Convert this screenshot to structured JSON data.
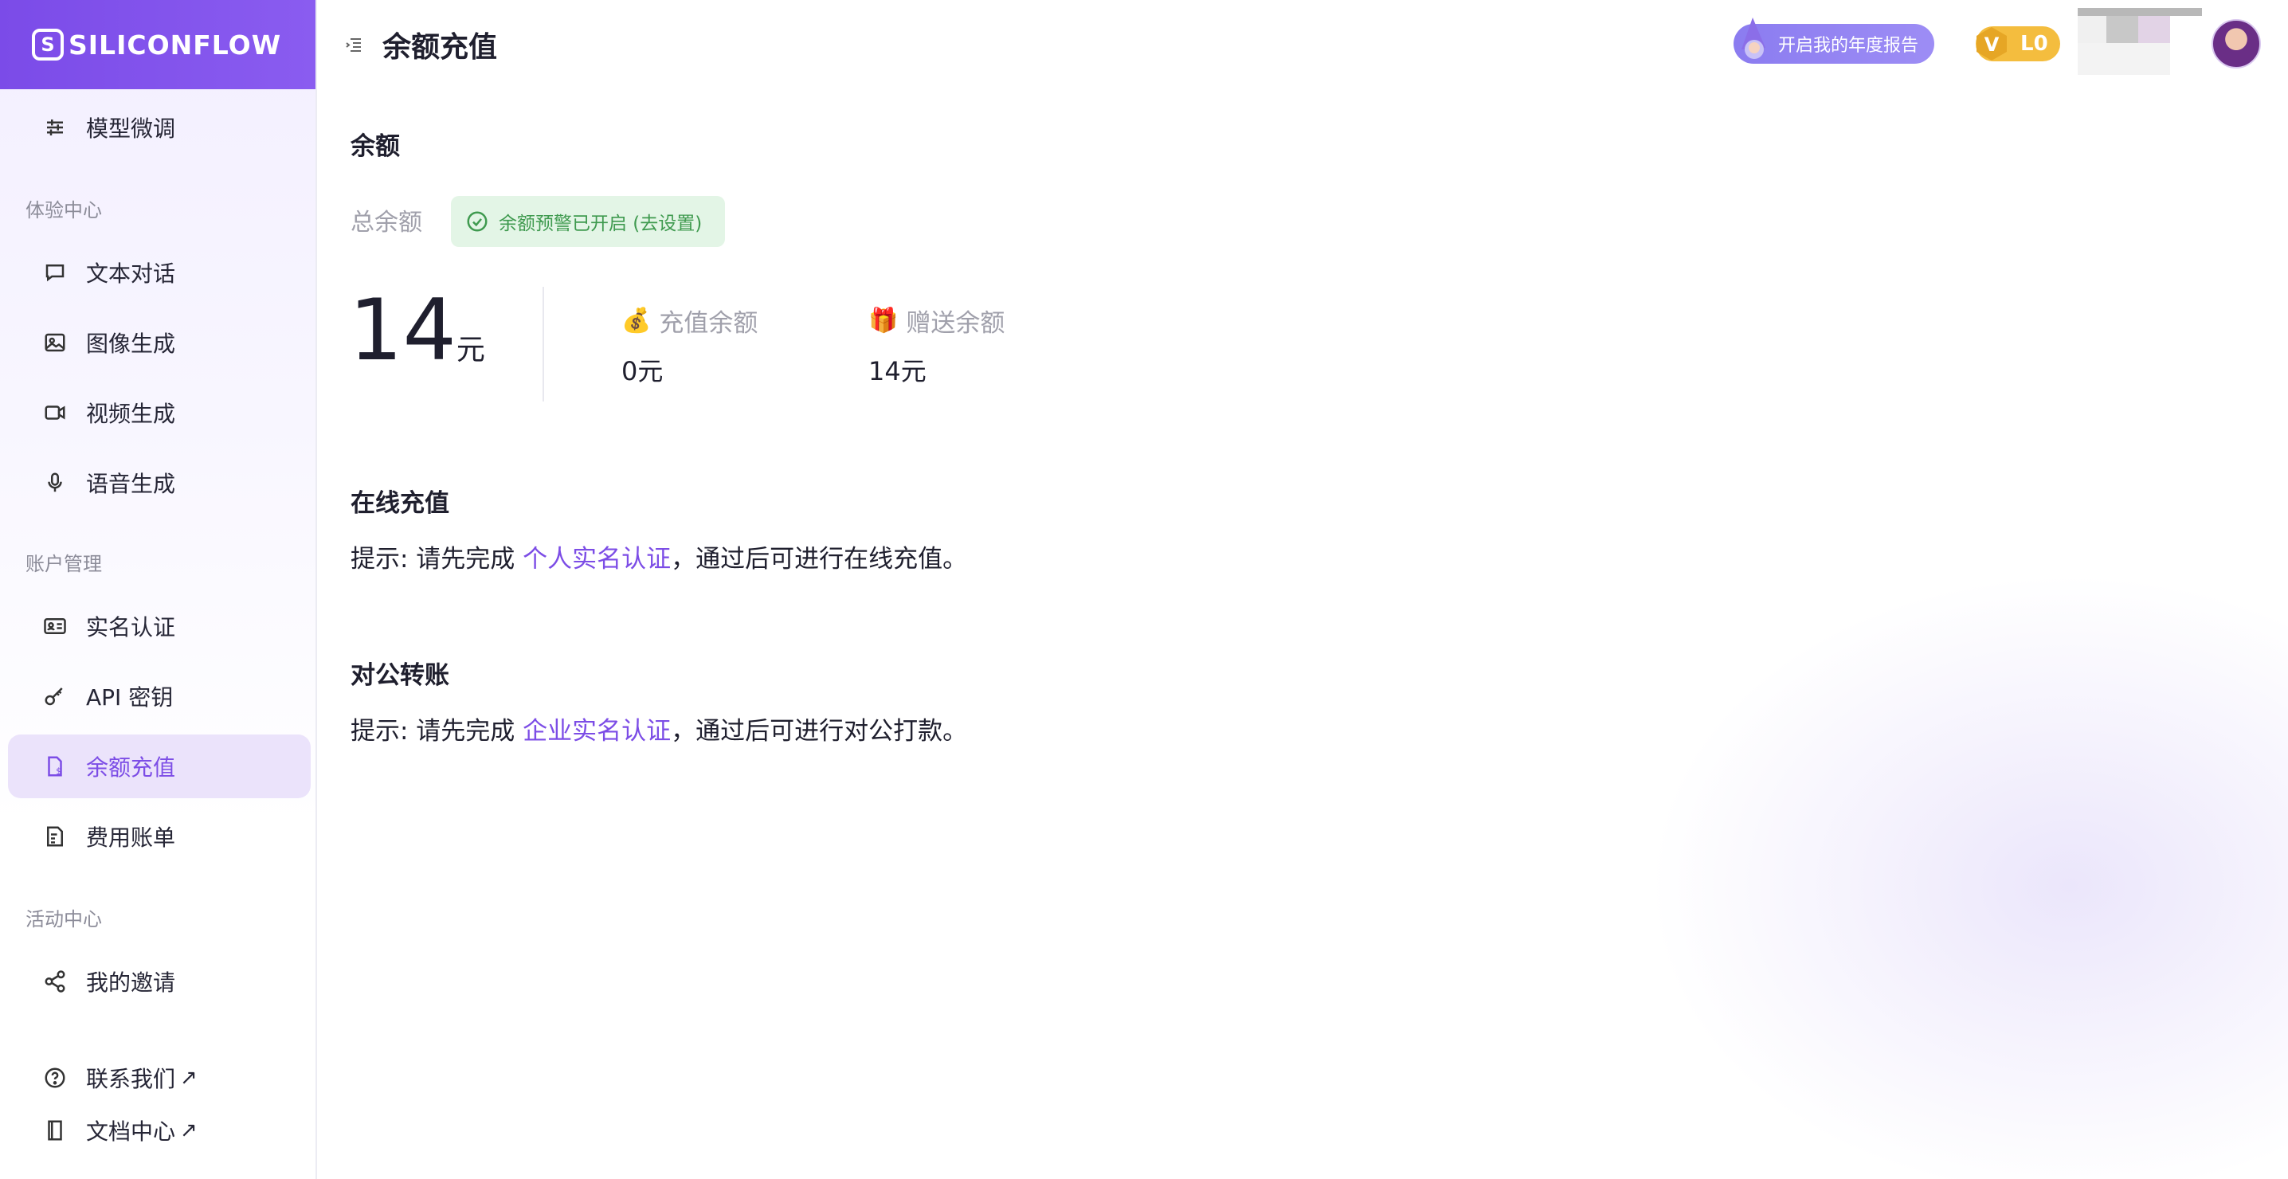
{
  "brand": {
    "name": "SILICONFLOW"
  },
  "sidebar": {
    "top_item": {
      "label": "模型微调",
      "icon": "sliders-icon"
    },
    "sections": [
      {
        "label": "体验中心"
      },
      {
        "label": "账户管理"
      },
      {
        "label": "活动中心"
      }
    ],
    "items": [
      {
        "label": "文本对话",
        "icon": "chat-icon"
      },
      {
        "label": "图像生成",
        "icon": "image-icon"
      },
      {
        "label": "视频生成",
        "icon": "video-icon"
      },
      {
        "label": "语音生成",
        "icon": "mic-icon"
      },
      {
        "label": "实名认证",
        "icon": "id-card-icon"
      },
      {
        "label": "API 密钥",
        "icon": "key-icon"
      },
      {
        "label": "余额充值",
        "icon": "recharge-icon",
        "active": true
      },
      {
        "label": "费用账单",
        "icon": "bill-icon"
      },
      {
        "label": "我的邀请",
        "icon": "share-icon"
      }
    ],
    "footer": [
      {
        "label": "联系我们",
        "suffix": "↗",
        "icon": "help-circle-icon"
      },
      {
        "label": "文档中心",
        "suffix": "↗",
        "icon": "book-icon"
      }
    ]
  },
  "header": {
    "title": "余额充值",
    "report_button": "开启我的年度报告",
    "level": "L0"
  },
  "balance": {
    "heading": "余额",
    "total_label": "总余额",
    "alert_chip": "余额预警已开启 (去设置)",
    "total_value": "14",
    "unit": "元",
    "recharge": {
      "label": "充值余额",
      "value": "0元",
      "emoji": "💰"
    },
    "gift": {
      "label": "赠送余额",
      "value": "14元",
      "emoji": "🎁"
    }
  },
  "online": {
    "heading": "在线充值",
    "tip_prefix": "提示: 请先完成 ",
    "tip_link": "个人实名认证",
    "tip_suffix": "，通过后可进行在线充值。"
  },
  "corporate": {
    "heading": "对公转账",
    "tip_prefix": "提示: 请先完成 ",
    "tip_link": "企业实名认证",
    "tip_suffix": "，通过后可进行对公打款。"
  },
  "colors": {
    "accent": "#7c4de6",
    "brand": "#7b4be8",
    "success": "#3f9a4f",
    "badge": "#f4bd3e"
  }
}
